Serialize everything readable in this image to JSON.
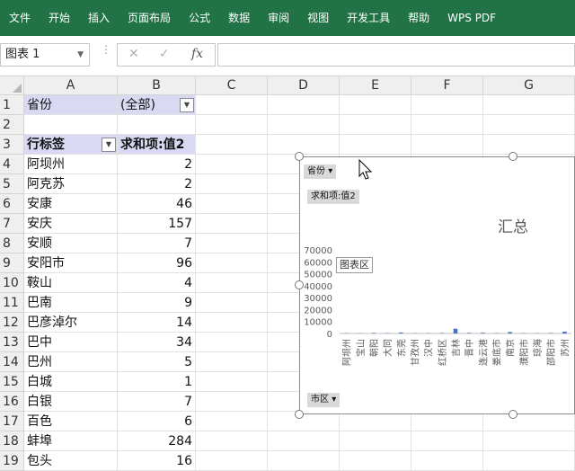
{
  "ribbon": {
    "tabs": [
      "文件",
      "开始",
      "插入",
      "页面布局",
      "公式",
      "数据",
      "审阅",
      "视图",
      "开发工具",
      "帮助",
      "WPS PDF"
    ]
  },
  "formula_bar": {
    "name_box": "图表 1",
    "formula": ""
  },
  "columns": [
    "A",
    "B",
    "C",
    "D",
    "E",
    "F",
    "G"
  ],
  "rows": [
    "1",
    "2",
    "3",
    "4",
    "5",
    "6",
    "7",
    "8",
    "9",
    "10",
    "11",
    "12",
    "13",
    "14",
    "15",
    "16",
    "17",
    "18",
    "19"
  ],
  "pivot": {
    "filter_label": "省份",
    "filter_value": "(全部)",
    "row_label_header": "行标签",
    "value_header": "求和项:值2",
    "items": [
      {
        "name": "阿坝州",
        "value": "2"
      },
      {
        "name": "阿克苏",
        "value": "2"
      },
      {
        "name": "安康",
        "value": "46"
      },
      {
        "name": "安庆",
        "value": "157"
      },
      {
        "name": "安顺",
        "value": "7"
      },
      {
        "name": "安阳市",
        "value": "96"
      },
      {
        "name": "鞍山",
        "value": "4"
      },
      {
        "name": "巴南",
        "value": "9"
      },
      {
        "name": "巴彦淖尔",
        "value": "14"
      },
      {
        "name": "巴中",
        "value": "34"
      },
      {
        "name": "巴州",
        "value": "5"
      },
      {
        "name": "白城",
        "value": "1"
      },
      {
        "name": "白银",
        "value": "7"
      },
      {
        "name": "百色",
        "value": "6"
      },
      {
        "name": "蚌埠",
        "value": "284"
      },
      {
        "name": "包头",
        "value": "16"
      }
    ]
  },
  "chart": {
    "filter_button": "省份",
    "value_button": "求和项:值2",
    "axis_button": "市区",
    "tooltip": "图表区"
  },
  "chart_data": {
    "type": "bar",
    "title": "汇总",
    "categories": [
      "阿坝州",
      "宝山",
      "朝阳",
      "大同",
      "东莞",
      "甘孜州",
      "汉中",
      "红桥区",
      "吉林",
      "晋中",
      "连云港",
      "娄底市",
      "南京",
      "濮阳市",
      "琼海",
      "邵阳市",
      "苏州"
    ],
    "values": [
      300,
      200,
      500,
      300,
      800,
      200,
      300,
      400,
      4000,
      500,
      600,
      300,
      1200,
      300,
      200,
      400,
      1500
    ],
    "ylim": [
      0,
      70000
    ],
    "yticks": [
      "0",
      "10000",
      "20000",
      "30000",
      "40000",
      "50000",
      "60000",
      "70000"
    ],
    "legend": "none",
    "bar_color": "#4472c4"
  }
}
